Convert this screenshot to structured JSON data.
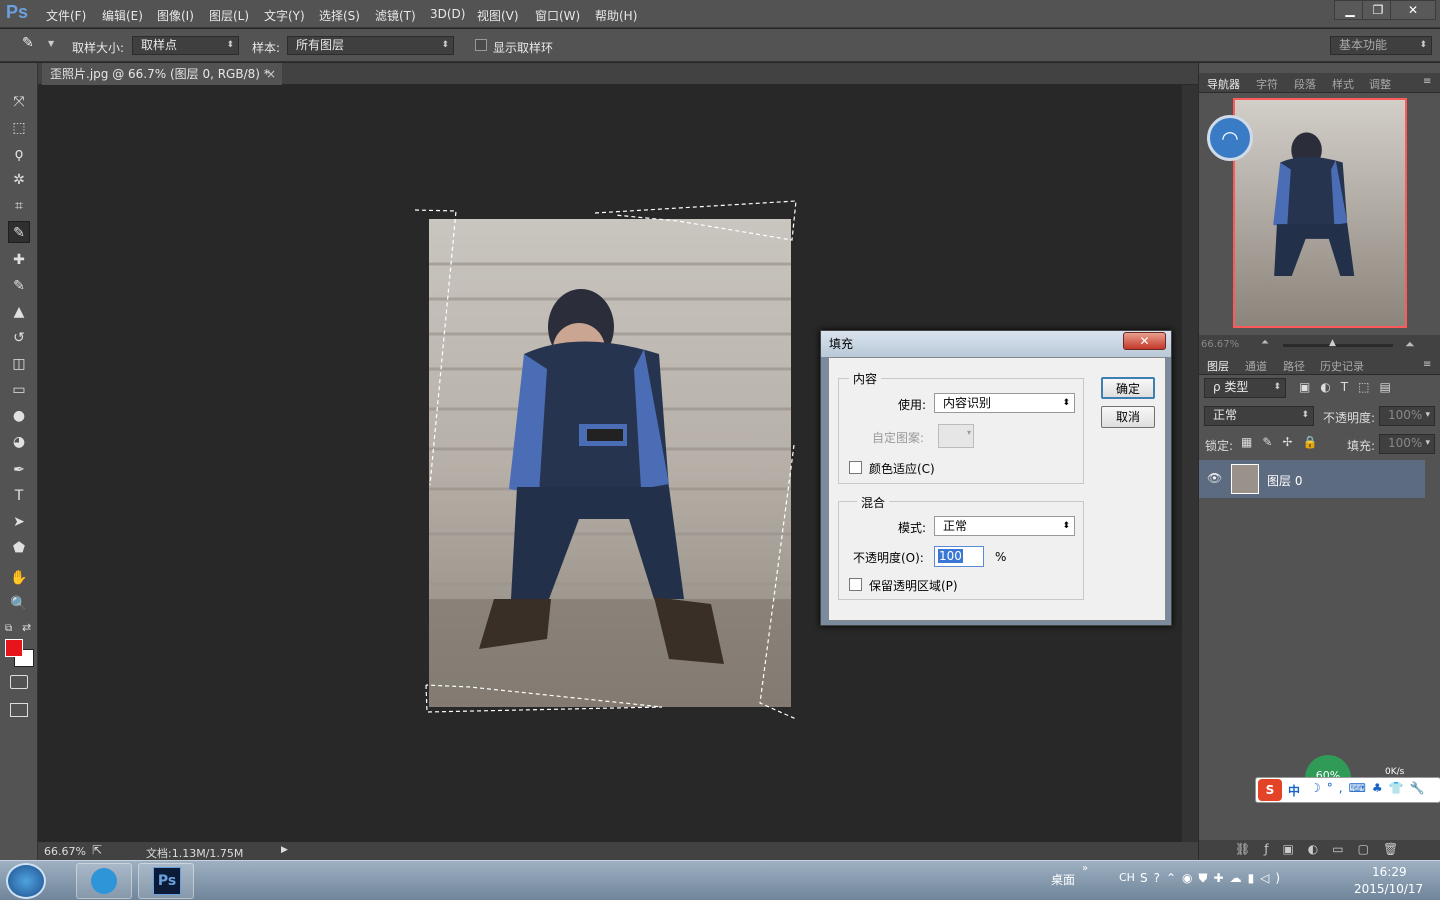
{
  "app": {
    "logo": "Ps"
  },
  "menu": [
    "文件(F)",
    "编辑(E)",
    "图像(I)",
    "图层(L)",
    "文字(Y)",
    "选择(S)",
    "滤镜(T)",
    "3D(D)",
    "视图(V)",
    "窗口(W)",
    "帮助(H)"
  ],
  "window_controls": {
    "minimize": "▁",
    "restore": "❐",
    "close": "✕"
  },
  "options": {
    "sample_size_label": "取样大小:",
    "sample_size_value": "取样点",
    "sample_label": "样本:",
    "sample_value": "所有图层",
    "show_ring_label": "显示取样环",
    "workspace": "基本功能"
  },
  "document": {
    "tab_title": "歪照片.jpg @ 66.7% (图层 0, RGB/8) *",
    "tab_close": "×",
    "zoom": "66.67%",
    "doc_size": "文档:1.13M/1.75M"
  },
  "tools": [
    "move-tool",
    "marquee-tool",
    "lasso-tool",
    "magic-wand-tool",
    "crop-tool",
    "eyedropper-tool",
    "healing-brush-tool",
    "brush-tool",
    "clone-stamp-tool",
    "history-brush-tool",
    "eraser-tool",
    "gradient-tool",
    "blur-tool",
    "dodge-tool",
    "pen-tool",
    "type-tool",
    "path-selection-tool",
    "shape-tool",
    "hand-tool",
    "zoom-tool"
  ],
  "tool_glyphs": [
    "⤧",
    "⬚",
    "ϙ",
    "✲",
    "⌗",
    "✎",
    "✚",
    "✎",
    "▲",
    "↺",
    "◫",
    "▭",
    "●",
    "◕",
    "✒",
    "T",
    "➤",
    "⬟",
    "✋",
    "🔍"
  ],
  "colors": {
    "foreground": "#e8141c",
    "background": "#ffffff",
    "panel": "#535353",
    "canvas": "#282828",
    "selection_frame": "#ff5a5a"
  },
  "navigator": {
    "tabs": [
      "导航器",
      "字符",
      "段落",
      "样式",
      "调整"
    ],
    "zoom": "66.67%"
  },
  "layers_panel": {
    "tabs": [
      "图层",
      "通道",
      "路径",
      "历史记录"
    ],
    "filter_label": "ρ 类型",
    "blend_mode": "正常",
    "opacity_label": "不透明度:",
    "opacity_value": "100%",
    "lock_label": "锁定:",
    "fill_label": "填充:",
    "fill_value": "100%",
    "layer_name": "图层 0"
  },
  "dialog": {
    "title": "填充",
    "close": "✕",
    "content_group": "内容",
    "use_label": "使用:",
    "use_value": "内容识别",
    "custom_pattern_label": "自定图案:",
    "color_adapt_label": "颜色适应(C)",
    "blend_group": "混合",
    "mode_label": "模式:",
    "mode_value": "正常",
    "opacity_label": "不透明度(O):",
    "opacity_value": "100",
    "percent": "%",
    "preserve_label": "保留透明区域(P)",
    "ok": "确定",
    "cancel": "取消"
  },
  "ime": {
    "mode": "中",
    "net_percent": "60%",
    "net_speed": "0K/s"
  },
  "taskbar": {
    "desktop_label": "桌面",
    "lang": "CH",
    "time": "16:29",
    "date": "2015/10/17",
    "ps_label": "Ps"
  }
}
